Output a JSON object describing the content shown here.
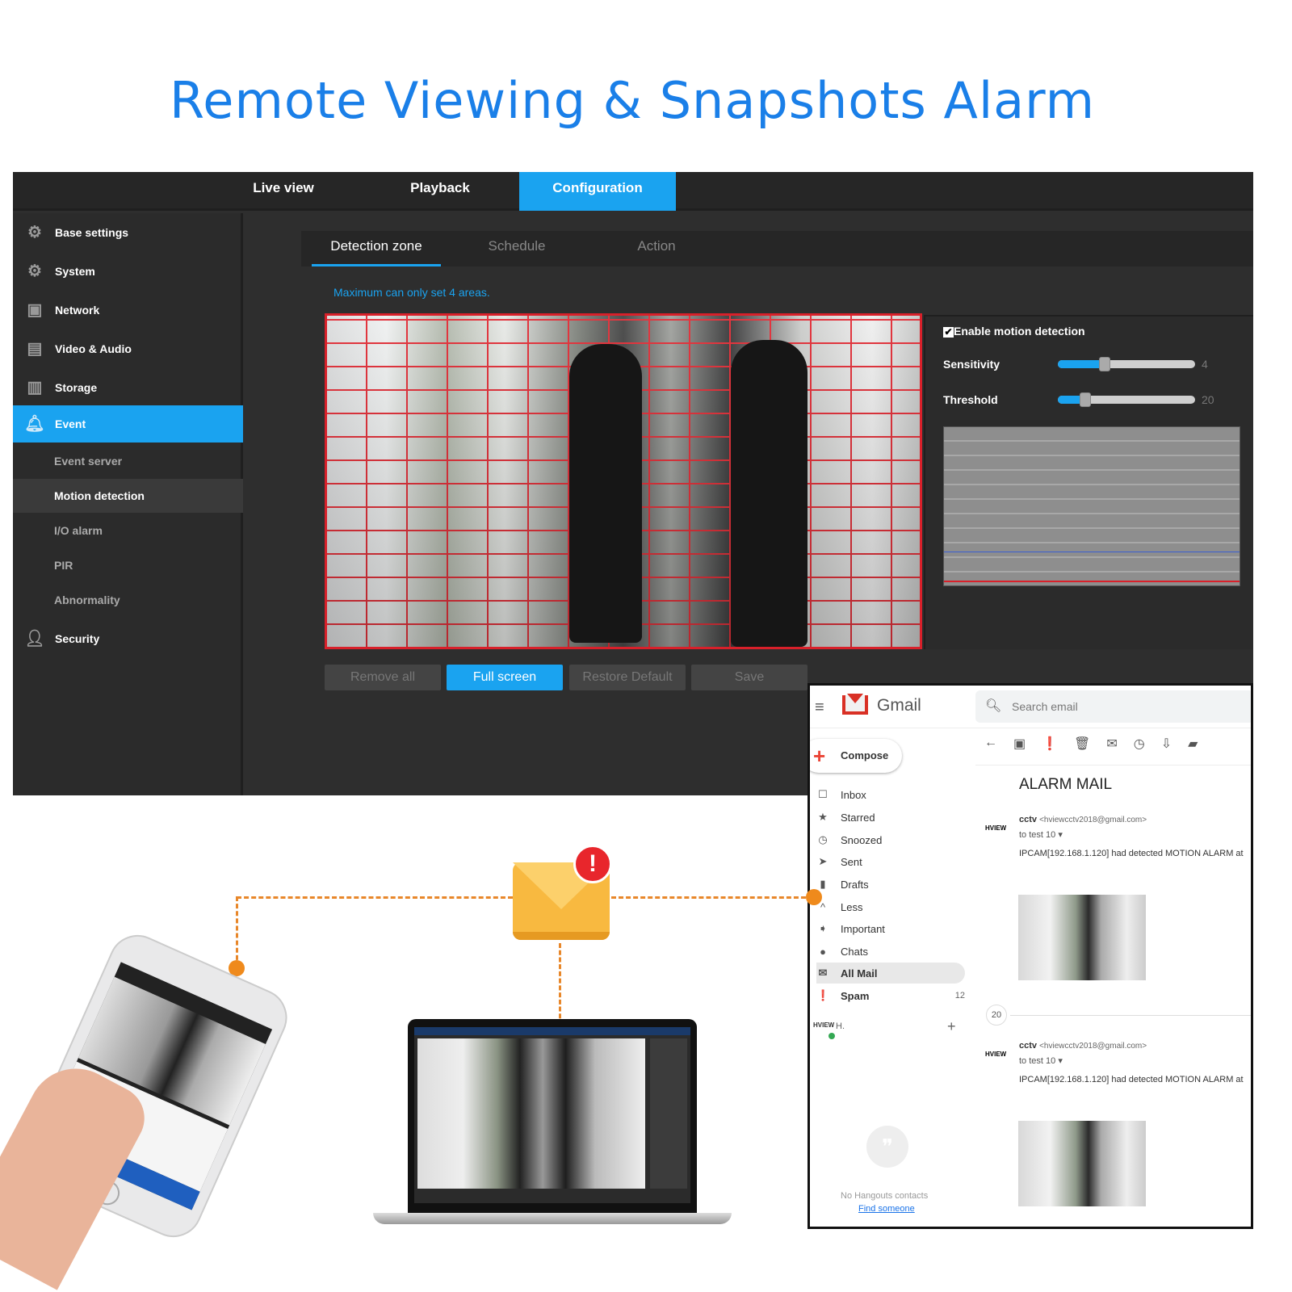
{
  "title": "Remote Viewing & Snapshots Alarm",
  "top_tabs": [
    {
      "label": "Live view"
    },
    {
      "label": "Playback"
    },
    {
      "label": "Configuration",
      "active": true
    }
  ],
  "sidebar": {
    "items": [
      {
        "label": "Base settings",
        "icon": "gear-icon"
      },
      {
        "label": "System",
        "icon": "gears-icon"
      },
      {
        "label": "Network",
        "icon": "network-icon"
      },
      {
        "label": "Video & Audio",
        "icon": "clapper-icon"
      },
      {
        "label": "Storage",
        "icon": "floppy-icon"
      },
      {
        "label": "Event",
        "icon": "bell-icon",
        "active": true
      },
      {
        "label": "Security",
        "icon": "user-gear-icon"
      }
    ],
    "event_sub": [
      {
        "label": "Event server"
      },
      {
        "label": "Motion detection",
        "selected": true
      },
      {
        "label": "I/O alarm"
      },
      {
        "label": "PIR"
      },
      {
        "label": "Abnormality"
      }
    ]
  },
  "sub_tabs": [
    {
      "label": "Detection zone",
      "active": true
    },
    {
      "label": "Schedule"
    },
    {
      "label": "Action"
    }
  ],
  "hint": "Maximum can only set 4 areas.",
  "motion": {
    "enable_label": "Enable motion detection",
    "enabled": true,
    "sensitivity": {
      "label": "Sensitivity",
      "value": "4",
      "fraction": 0.34
    },
    "threshold": {
      "label": "Threshold",
      "value": "20",
      "fraction": 0.2
    }
  },
  "buttons": {
    "remove_all": "Remove all",
    "full_screen": "Full screen",
    "restore": "Restore Default",
    "save": "Save"
  },
  "gmail": {
    "brand": "Gmail",
    "search_placeholder": "Search email",
    "compose": "Compose",
    "nav": [
      {
        "label": "Inbox",
        "icon": "inbox-icon"
      },
      {
        "label": "Starred",
        "icon": "star-icon"
      },
      {
        "label": "Snoozed",
        "icon": "clock-icon"
      },
      {
        "label": "Sent",
        "icon": "send-icon"
      },
      {
        "label": "Drafts",
        "icon": "draft-icon"
      },
      {
        "label": "Less",
        "icon": "chevron-up-icon"
      },
      {
        "label": "Important",
        "icon": "important-icon"
      },
      {
        "label": "Chats",
        "icon": "chat-icon"
      },
      {
        "label": "All Mail",
        "icon": "mail-icon"
      },
      {
        "label": "Spam",
        "icon": "spam-icon",
        "count": "12"
      }
    ],
    "hangouts_user": "H.",
    "no_contacts": "No Hangouts contacts",
    "find_someone": "Find someone",
    "subject": "ALARM MAIL",
    "thread_count": "20",
    "messages": [
      {
        "sender": "cctv",
        "email": "<hviewcctv2018@gmail.com>",
        "to": "to test 10",
        "body": "IPCAM[192.168.1.120] had detected MOTION ALARM at",
        "logo": "HVIEW"
      },
      {
        "sender": "cctv",
        "email": "<hviewcctv2018@gmail.com>",
        "to": "to test 10",
        "body": "IPCAM[192.168.1.120] had detected MOTION ALARM at",
        "logo": "HVIEW"
      }
    ]
  },
  "colors": {
    "accent": "#1aa3f0",
    "title": "#1a7fe8",
    "zone": "#d8202a",
    "connector": "#e8872a",
    "alert": "#e8262c"
  }
}
